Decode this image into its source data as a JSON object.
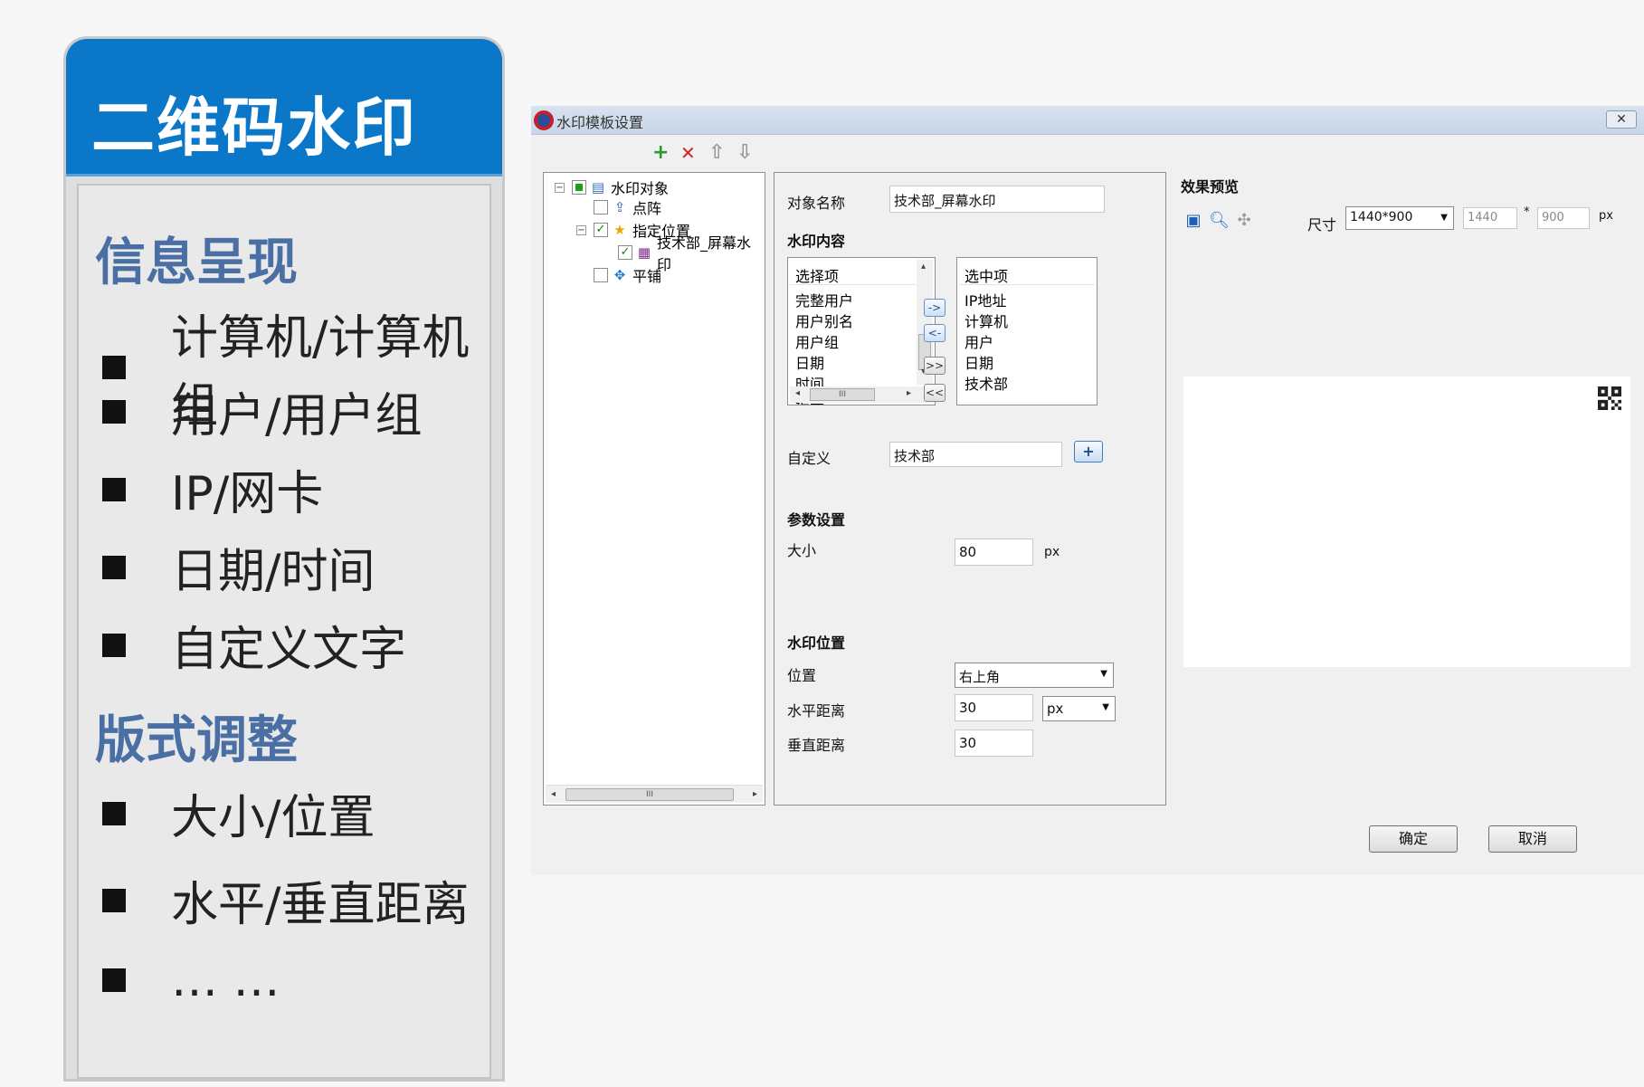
{
  "slide": {
    "title": "二维码水印",
    "section1": "信息呈现",
    "section1_items": [
      "计算机/计算机组",
      "用户/用户组",
      "IP/网卡",
      "日期/时间",
      "自定义文字"
    ],
    "section2": "版式调整",
    "section2_items": [
      "大小/位置",
      "水平/垂直距离",
      "… …"
    ]
  },
  "dialog": {
    "title": "水印模板设置",
    "close_label": "✕",
    "toolbar": {
      "add": "+",
      "delete": "✕",
      "up": "⇧",
      "down": "⇩"
    },
    "tree": {
      "root": "水印对象",
      "items": [
        "点阵",
        "指定位置",
        "技术部_屏幕水印",
        "平铺"
      ],
      "scroll_thumb": "III"
    },
    "form": {
      "object_name_label": "对象名称",
      "object_name_value": "技术部_屏幕水印",
      "content_section": "水印内容",
      "available_header": "选择项",
      "available_items": [
        "完整用户",
        "用户别名",
        "用户组",
        "日期",
        "时间",
        "编号"
      ],
      "selected_header": "选中项",
      "selected_items": [
        "IP地址",
        "计算机",
        "用户",
        "日期",
        "技术部"
      ],
      "move_buttons": [
        "->",
        "<-",
        ">>",
        "<<"
      ],
      "custom_label": "自定义",
      "custom_value": "技术部",
      "custom_add": "+",
      "params_section": "参数设置",
      "size_label": "大小",
      "size_value": "80",
      "size_unit": "px",
      "position_section": "水印位置",
      "position_label": "位置",
      "position_value": "右上角",
      "hdist_label": "水平距离",
      "hdist_value": "30",
      "hdist_unit": "px",
      "vdist_label": "垂直距离",
      "vdist_value": "30",
      "list_scroll_thumb": "III"
    },
    "preview": {
      "title": "效果预览",
      "size_label": "尺寸",
      "size_preset": "1440*900",
      "width": "1440",
      "times": "*",
      "height": "900",
      "unit": "px"
    },
    "ok_label": "确定",
    "cancel_label": "取消"
  }
}
